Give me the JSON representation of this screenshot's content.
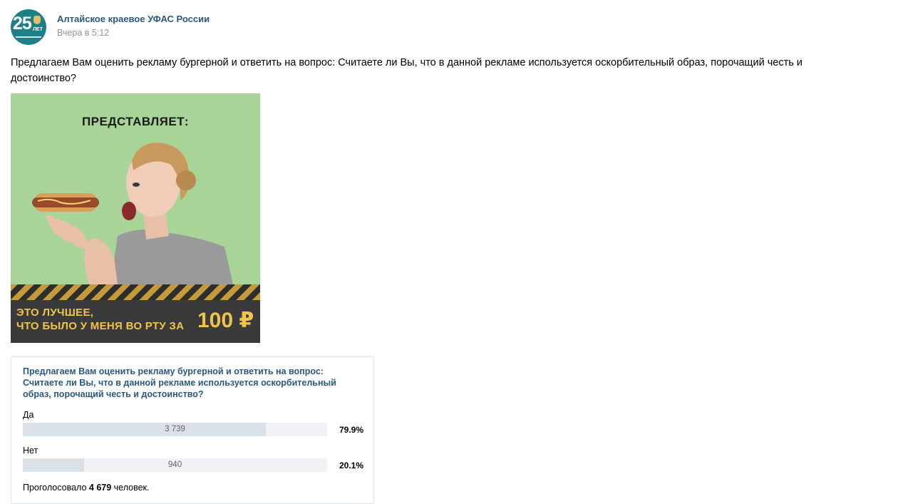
{
  "post": {
    "author": "Алтайское краевое УФАС России",
    "date": "Вчера в 5:12",
    "avatar": {
      "number": "25",
      "sub": "ЛЕТ"
    },
    "text": "Предлагаем Вам оценить рекламу бургерной и ответить на вопрос: Считаете ли Вы, что в данной рекламе используется оскорбительный образ, порочащий честь и достоинство?"
  },
  "ad_image": {
    "top_text": "ПРЕДСТАВЛЯЕТ:",
    "slogan_line1": "ЭТО ЛУЧШЕЕ,",
    "slogan_line2": "ЧТО БЫЛО У МЕНЯ ВО РТУ ЗА",
    "price": "100 ₽",
    "colors": {
      "background": "#a8d498",
      "band": "#3a3a3a",
      "accent": "#f0c44a"
    }
  },
  "poll": {
    "question": "Предлагаем Вам оценить рекламу бургерной и ответить на вопрос: Считаете ли Вы, что в данной рекламе используется оскорбительный образ, порочащий честь и достоинство?",
    "options": [
      {
        "label": "Да",
        "count": "3 739",
        "percent": "79.9%",
        "fraction": 0.799
      },
      {
        "label": "Нет",
        "count": "940",
        "percent": "20.1%",
        "fraction": 0.201
      }
    ],
    "total_prefix": "Проголосовало",
    "total_count": "4 679",
    "total_suffix": "человек."
  },
  "colors": {
    "link": "#2a5885",
    "muted": "#939393",
    "bar_fill": "#dae1e8",
    "bar_track": "#f0f2f5"
  }
}
